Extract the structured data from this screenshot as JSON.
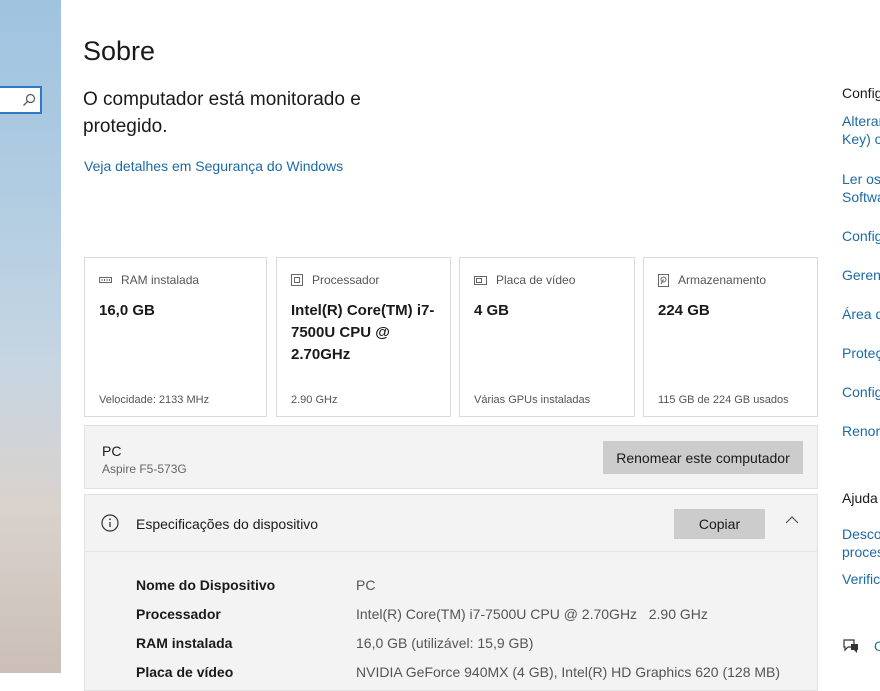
{
  "page": {
    "title": "Sobre",
    "status_text": "O computador está monitorado e protegido.",
    "security_link": "Veja detalhes em Segurança do Windows"
  },
  "cards": [
    {
      "icon": "ram-icon",
      "label": "RAM instalada",
      "value": "16,0 GB",
      "sub": "Velocidade: 2133 MHz"
    },
    {
      "icon": "processor-icon",
      "label": "Processador",
      "value": "Intel(R) Core(TM) i7-7500U CPU @ 2.70GHz",
      "sub": "2.90 GHz"
    },
    {
      "icon": "graphics-card-icon",
      "label": "Placa de vídeo",
      "value": "4 GB",
      "sub": "Várias GPUs instaladas"
    },
    {
      "icon": "storage-icon",
      "label": "Armazenamento",
      "value": "224 GB",
      "sub": "115 GB de 224 GB usados"
    }
  ],
  "pc": {
    "name": "PC",
    "model": "Aspire F5-573G",
    "rename_label": "Renomear este computador"
  },
  "specs": {
    "title": "Especificações do dispositivo",
    "copy_label": "Copiar",
    "rows": [
      {
        "key": "Nome do Dispositivo",
        "value": "PC"
      },
      {
        "key": "Processador",
        "value": "Intel(R) Core(TM) i7-7500U CPU @ 2.70GHz   2.90 GHz"
      },
      {
        "key": "RAM instalada",
        "value": "16,0 GB (utilizável: 15,9 GB)"
      },
      {
        "key": "Placa de vídeo",
        "value": "NVIDIA GeForce 940MX (4 GB), Intel(R) HD Graphics 620 (128 MB)"
      }
    ]
  },
  "right_column": {
    "related_heading": "Configu",
    "links": [
      "Alterar",
      "Key) o",
      "Ler os",
      "Softwa",
      "Config",
      "Gerenc",
      "Área d",
      "Proteç",
      "Config",
      "Renom"
    ],
    "help_heading": "Ajuda",
    "help_links": [
      "Desco",
      "proces",
      "Verific"
    ],
    "feedback_label": "O"
  },
  "colors": {
    "accent": "#1b6aa5",
    "focus_border": "#2d7bc4",
    "panel_bg": "#f3f3f3",
    "button_bg": "#cccccc"
  }
}
